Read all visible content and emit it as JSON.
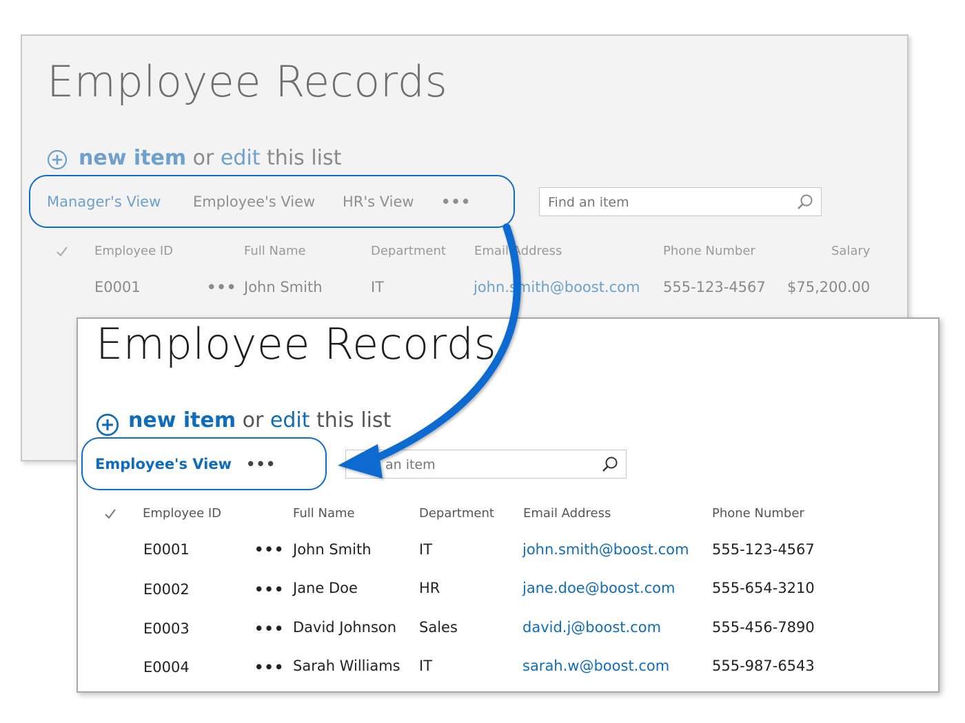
{
  "back": {
    "title": "Employee Records",
    "new_item": "new item",
    "or": "or",
    "edit": "edit",
    "this_list": "this list",
    "views": [
      "Manager's View",
      "Employee's View",
      "HR's View"
    ],
    "more": "•••",
    "search_placeholder": "Find an item",
    "columns": [
      "Employee ID",
      "Full Name",
      "Department",
      "Email Address",
      "Phone Number",
      "Salary"
    ],
    "row": {
      "id": "E0001",
      "name": "John Smith",
      "dept": "IT",
      "email": "john.smith@boost.com",
      "phone": "555-123-4567",
      "salary": "$75,200.00"
    }
  },
  "front": {
    "title": "Employee Records",
    "new_item": "new item",
    "or": "or",
    "edit": "edit",
    "this_list": "this list",
    "views": [
      "Employee's View"
    ],
    "more": "•••",
    "search_placeholder": "Find an item",
    "columns": [
      "Employee ID",
      "Full Name",
      "Department",
      "Email Address",
      "Phone Number"
    ],
    "rows": [
      {
        "id": "E0001",
        "name": "John Smith",
        "dept": "IT",
        "email": "john.smith@boost.com",
        "phone": "555-123-4567"
      },
      {
        "id": "E0002",
        "name": "Jane Doe",
        "dept": "HR",
        "email": "jane.doe@boost.com",
        "phone": "555-654-3210"
      },
      {
        "id": "E0003",
        "name": "David Johnson",
        "dept": "Sales",
        "email": "david.j@boost.com",
        "phone": "555-456-7890"
      },
      {
        "id": "E0004",
        "name": "Sarah Williams",
        "dept": "IT",
        "email": "sarah.w@boost.com",
        "phone": "555-987-6543"
      }
    ]
  },
  "colors": {
    "accent": "#0f6cbd",
    "faded_accent": "#6ea0cc",
    "arrow": "#0b6bd0"
  },
  "icons": {
    "plus": "plus-circle-icon",
    "search": "search-icon",
    "check": "checkmark-icon",
    "arrow": "curved-arrow-icon"
  }
}
